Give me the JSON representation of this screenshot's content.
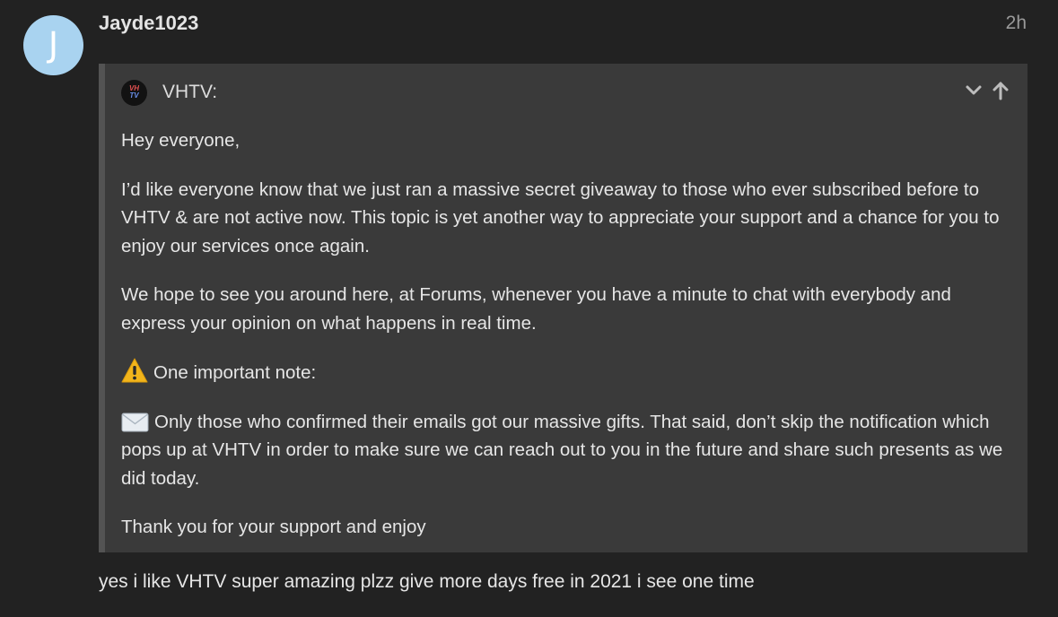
{
  "post": {
    "avatar_letter": "J",
    "username": "Jayde1023",
    "date": "2h",
    "avatar_color": "#a9d3f0"
  },
  "quote": {
    "avatar_logo_line1": "VH",
    "avatar_logo_line2": "TV",
    "author": "VHTV:",
    "collapse_icon": "chevron-down-icon",
    "jump_icon": "arrow-up-icon",
    "paragraphs": {
      "p1": "Hey everyone,",
      "p2": "I’d like everyone know that we just ran a massive secret giveaway to those who ever subscribed before to VHTV & are not active now. This topic is yet another way to appreciate your support and a chance for you to enjoy our services once again.",
      "p3": "We hope to see you around here, at Forums, whenever you have a minute to chat with everybody and express your opinion on what happens in real time.",
      "p4": "One important note:",
      "p5": "Only those who confirmed their emails got our massive gifts. That said, don’t skip the notification which pops up at VHTV in order to make sure we can reach out to you in the future and share such presents as we did today.",
      "p6": "Thank you for your support and enjoy"
    },
    "warning_icon": "warning-icon",
    "envelope_icon": "envelope-icon"
  },
  "reply_text": "yes i like VHTV super amazing plzz give more days free in 2021 i see one time"
}
